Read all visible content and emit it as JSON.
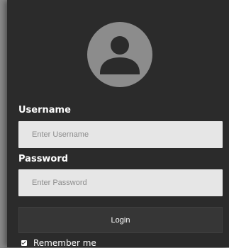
{
  "login_form": {
    "avatar_icon": "user-avatar-icon",
    "username_label": "Username",
    "username_placeholder": "Enter Username",
    "username_value": "",
    "password_label": "Password",
    "password_placeholder": "Enter Password",
    "password_value": "",
    "login_label": "Login",
    "remember_label": "Remember me",
    "remember_checked": true
  },
  "colors": {
    "card_background": "#2b2b2b",
    "page_background": "#8a8a8a",
    "avatar_background": "#8c8c8c",
    "avatar_figure": "#2b2b2b",
    "input_background": "#e6e6e6",
    "button_background": "#363636",
    "text": "#ffffff"
  }
}
